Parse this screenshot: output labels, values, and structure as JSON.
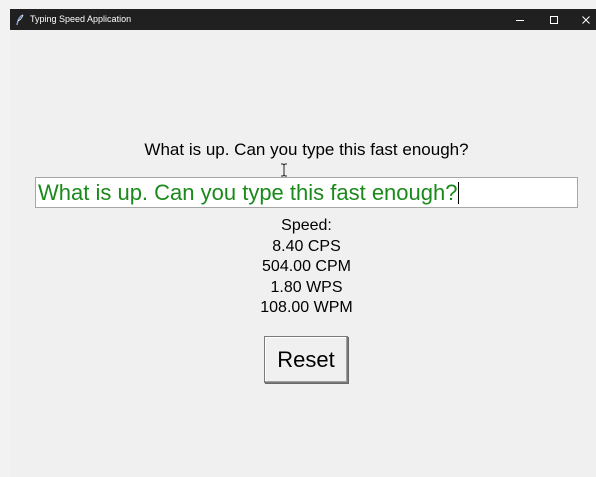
{
  "window": {
    "title": "Typing Speed Application",
    "icon": "feather-icon",
    "controls": {
      "minimize": "minimize-icon",
      "maximize": "maximize-icon",
      "close": "close-icon"
    }
  },
  "prompt": {
    "text": "What is up. Can you type this fast enough?"
  },
  "entry": {
    "value": "What is up. Can you type this fast enough?",
    "text_color": "#1a8a1a"
  },
  "speed": {
    "label": "Speed:",
    "cps": "8.40 CPS",
    "cpm": "504.00 CPM",
    "wps": "1.80 WPS",
    "wpm": "108.00 WPM"
  },
  "reset_button": {
    "label": "Reset"
  },
  "colors": {
    "titlebar": "#202020",
    "background": "#f0f0f0"
  }
}
